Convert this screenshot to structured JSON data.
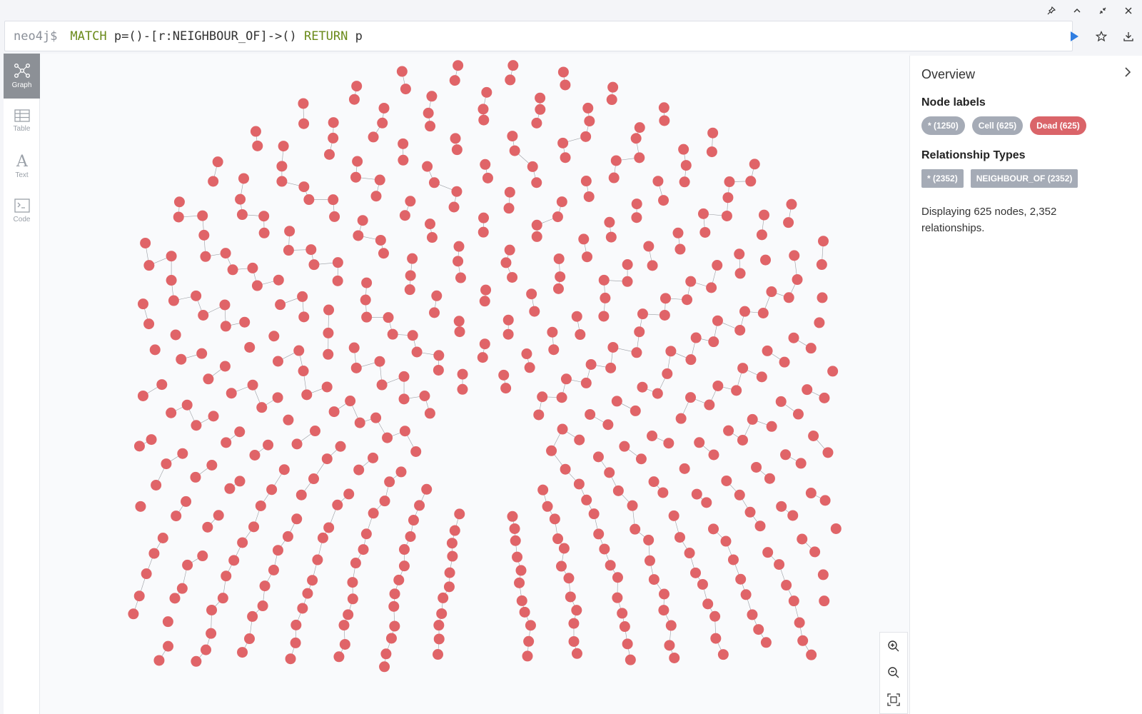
{
  "editor": {
    "prompt": "neo4j$",
    "query_kw1": "MATCH",
    "query_mid": " p=()-[r:NEIGHBOUR_OF]->() ",
    "query_kw2": "RETURN",
    "query_end": " p"
  },
  "nav": {
    "graph": "Graph",
    "table": "Table",
    "text": "Text",
    "code": "Code"
  },
  "overview": {
    "title": "Overview",
    "node_labels_title": "Node labels",
    "node_labels": [
      "* (1250)",
      "Cell (625)",
      "Dead (625)"
    ],
    "rel_types_title": "Relationship Types",
    "rel_types": [
      "* (2352)",
      "NEIGHBOUR_OF (2352)"
    ],
    "summary": "Displaying 625 nodes, 2,352 relationships."
  },
  "colors": {
    "node_fill": "#e06468",
    "edge": "#9a9da3",
    "accent_blue": "#2f7de1"
  },
  "icons": [
    "pin-icon",
    "chevron-up-icon",
    "minimize-icon",
    "close-icon",
    "play-icon",
    "star-icon",
    "download-icon",
    "graph-icon",
    "table-icon",
    "text-icon",
    "code-icon",
    "zoom-in-icon",
    "zoom-out-icon",
    "fit-icon",
    "chevron-right-icon"
  ]
}
